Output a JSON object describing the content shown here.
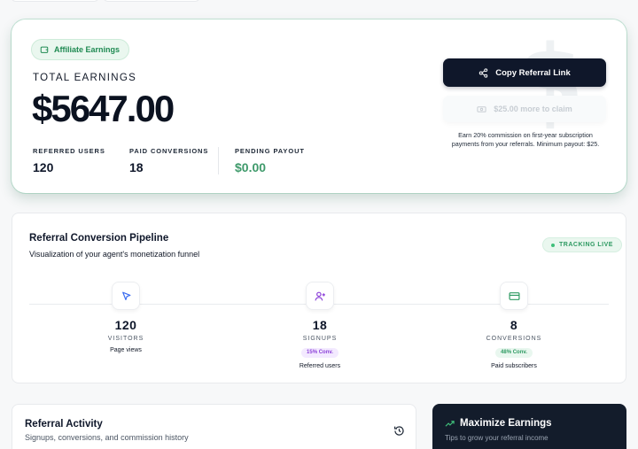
{
  "hero": {
    "badge_label": "Affiliate Earnings",
    "total_label": "TOTAL EARNINGS",
    "total_value": "$5647.00",
    "watermark": "$",
    "stats": [
      {
        "label": "REFERRED USERS",
        "value": "120"
      },
      {
        "label": "PAID CONVERSIONS",
        "value": "18"
      },
      {
        "label": "PENDING PAYOUT",
        "value": "$0.00"
      }
    ],
    "copy_button_label": "Copy Referral Link",
    "claim_button_label": "$25.00 more to claim",
    "commission_note": "Earn 20% commission on first-year subscription payments from your referrals. Minimum payout: $25."
  },
  "pipeline": {
    "title": "Referral Conversion Pipeline",
    "subtitle": "Visualization of your agent's monetization funnel",
    "live_label": "TRACKING LIVE",
    "stages": [
      {
        "value": "120",
        "label": "VISITORS",
        "rate": "",
        "description": "Page views",
        "icon": "cursor-icon"
      },
      {
        "value": "18",
        "label": "SIGNUPS",
        "rate": "15% Conv.",
        "description": "Referred users",
        "icon": "user-plus-icon"
      },
      {
        "value": "8",
        "label": "CONVERSIONS",
        "rate": "48% Conv.",
        "description": "Paid subscribers",
        "icon": "credit-card-icon"
      }
    ]
  },
  "activity": {
    "title": "Referral Activity",
    "subtitle": "Signups, conversions, and commission history"
  },
  "maximize": {
    "title": "Maximize Earnings",
    "subtitle": "Tips to grow your referral income"
  },
  "colors": {
    "accent_green": "#2e9a62",
    "dark_navy": "#0f172a",
    "purple": "#8b3fd8"
  }
}
